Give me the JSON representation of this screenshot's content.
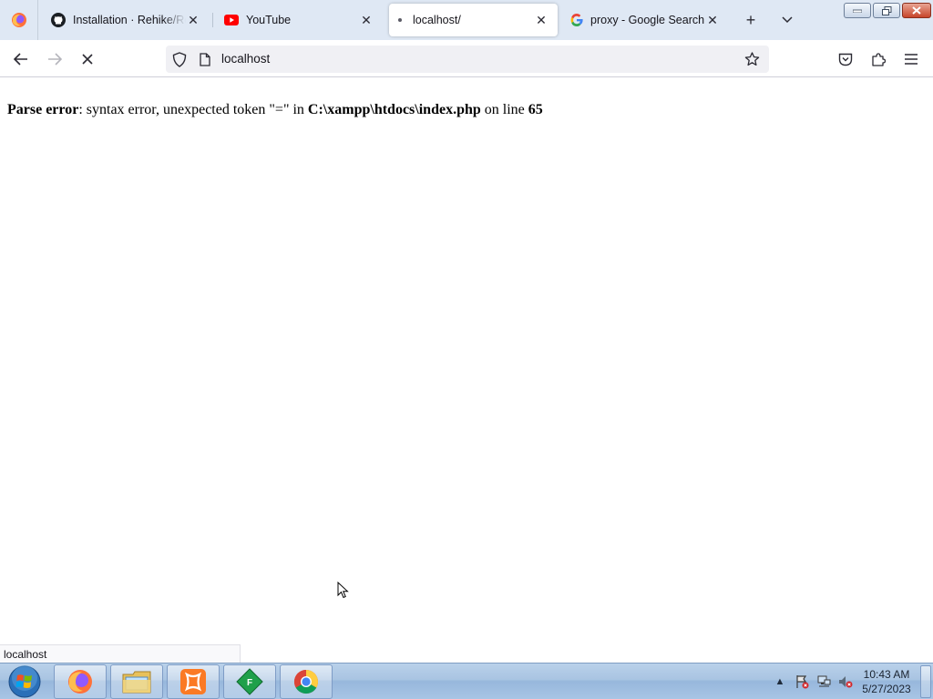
{
  "browser": {
    "tabs": [
      {
        "title": "Installation · Rehike/Rehike Wiki",
        "favicon": "github-icon",
        "active": false,
        "loading": false
      },
      {
        "title": "YouTube",
        "favicon": "youtube-icon",
        "active": false,
        "loading": false
      },
      {
        "title": "localhost/",
        "favicon": "loading-dot",
        "active": true,
        "loading": true
      },
      {
        "title": "proxy - Google Search",
        "favicon": "google-icon",
        "active": false,
        "loading": false
      }
    ],
    "new_tab_icon": "plus-icon",
    "tab_list_icon": "chevron-down-icon",
    "url": "localhost",
    "status_text": "localhost"
  },
  "page": {
    "error_label": "Parse error",
    "error_message": ": syntax error, unexpected token \"=\" in ",
    "file_path": "C:\\xampp\\htdocs\\index.php",
    "on_line_text": " on line ",
    "line_number": "65"
  },
  "taskbar": {
    "pinned": [
      {
        "name": "firefox",
        "icon": "firefox-icon"
      },
      {
        "name": "explorer",
        "icon": "folder-icon"
      },
      {
        "name": "xampp",
        "icon": "xampp-icon"
      },
      {
        "name": "fiddler",
        "icon": "diamond-f-icon"
      },
      {
        "name": "chrome",
        "icon": "chrome-icon"
      }
    ],
    "clock_time": "10:43 AM",
    "clock_date": "5/27/2023"
  },
  "colors": {
    "tabstrip_bg": "#dfe8f4",
    "active_tab_bg": "#ffffff",
    "urlbar_bg": "#f0f0f4",
    "taskbar_bg": "#a9c4e2"
  }
}
